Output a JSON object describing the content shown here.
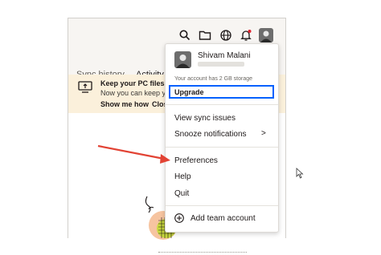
{
  "colors": {
    "accent": "#0061fe",
    "annotation_arrow": "#e24334",
    "banner_bg": "#fbf0db"
  },
  "toolbar": {
    "icons": [
      "search-icon",
      "folder-icon",
      "globe-icon",
      "bell-icon",
      "avatar"
    ]
  },
  "tabs": [
    {
      "label": "Sync history"
    },
    {
      "label": "Activity"
    }
  ],
  "banner": {
    "line1": "Keep your PC files ba",
    "line2": "Now you can keep you",
    "show_me_how": "Show me how",
    "close": "Clos"
  },
  "menu": {
    "user_name": "Shivam Malani",
    "storage_text": "Your account has 2 GB storage",
    "upgrade": "Upgrade",
    "view_sync_issues": "View sync issues",
    "snooze_notifications": "Snooze notifications",
    "chevron": ">",
    "preferences": "Preferences",
    "help": "Help",
    "quit": "Quit",
    "add_team_account": "Add team account"
  }
}
